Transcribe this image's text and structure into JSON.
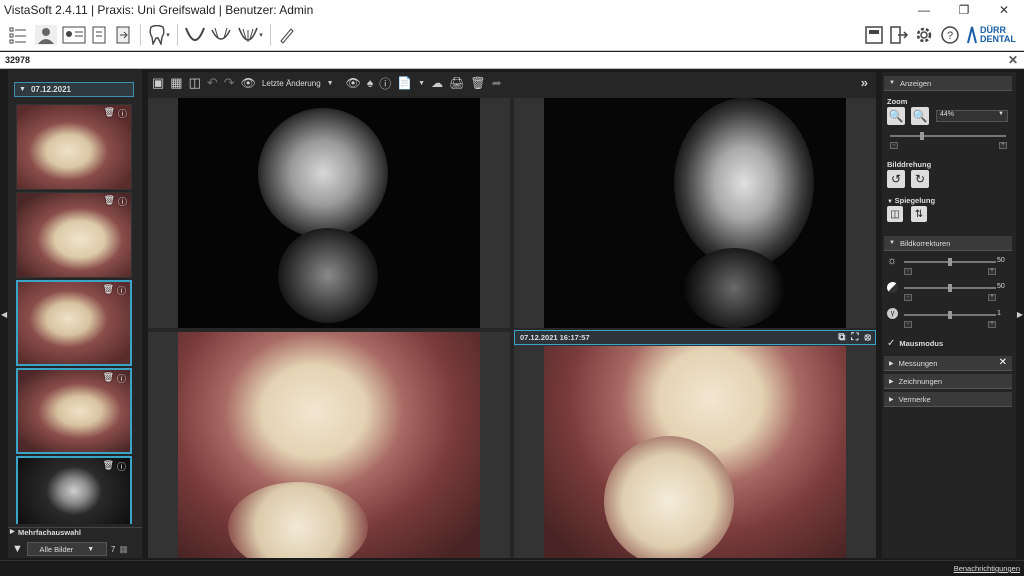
{
  "window": {
    "title": "VistaSoft 2.4.11 | Praxis: Uni Greifswald | Benutzer: Admin"
  },
  "patient": {
    "id": "32978"
  },
  "left": {
    "date_header": "07.12.2021",
    "multi_label": "Mehrfachauswahl",
    "filter_value": "Alle Bilder",
    "count": "7"
  },
  "viewer": {
    "history_label": "Letzte Änderung",
    "pane4_header": "07.12.2021 16:17:57"
  },
  "right": {
    "anzeigen": "Anzeigen",
    "zoom": "Zoom",
    "zoom_value": "44%",
    "bilddrehung": "Bilddrehung",
    "spiegelung": "Spiegelung",
    "bildkorrekturen": "Bildkorrekturen",
    "brightness": "50",
    "contrast": "50",
    "gamma": "1",
    "mausmodus": "Mausmodus",
    "messungen": "Messungen",
    "zeichnungen": "Zeichnungen",
    "vermerke": "Vermerke"
  },
  "status": {
    "notifications": "Benachrichtigungen"
  },
  "brand": {
    "line1": "DÜRR",
    "line2": "DENTAL"
  },
  "colors": {
    "accent": "#3aa3c8",
    "brand": "#1a5ea8"
  }
}
